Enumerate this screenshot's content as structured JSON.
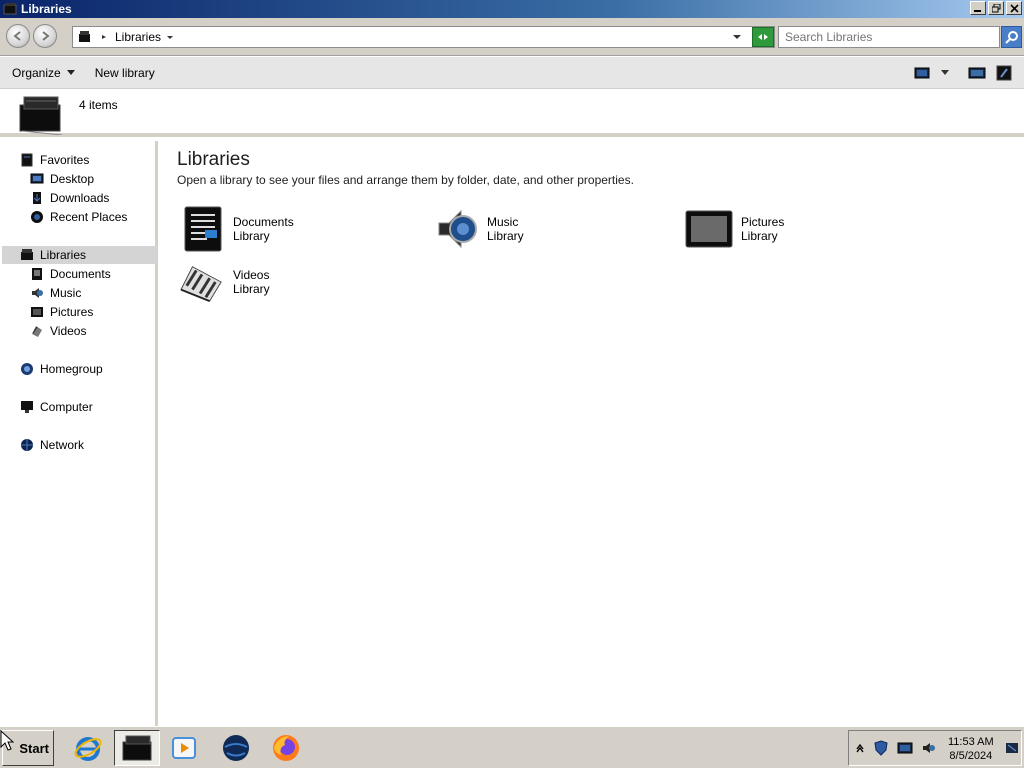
{
  "window": {
    "title": "Libraries"
  },
  "address": {
    "crumb": "Libraries",
    "search_placeholder": "Search Libraries"
  },
  "commands": {
    "organize": "Organize",
    "new_library": "New library"
  },
  "details": {
    "count": "4 items"
  },
  "nav": {
    "favorites": "Favorites",
    "desktop": "Desktop",
    "downloads": "Downloads",
    "recent": "Recent Places",
    "libraries": "Libraries",
    "documents": "Documents",
    "music": "Music",
    "pictures": "Pictures",
    "videos": "Videos",
    "homegroup": "Homegroup",
    "computer": "Computer",
    "network": "Network"
  },
  "content": {
    "heading": "Libraries",
    "description": "Open a library to see your files and arrange them by folder, date, and other properties.",
    "libraries": [
      {
        "name": "Documents",
        "type": "Library"
      },
      {
        "name": "Music",
        "type": "Library"
      },
      {
        "name": "Pictures",
        "type": "Library"
      },
      {
        "name": "Videos",
        "type": "Library"
      }
    ]
  },
  "taskbar": {
    "start": "Start",
    "time": "11:53 AM",
    "date": "8/5/2024"
  },
  "colors": {
    "titlebar": "#0a246a",
    "selection": "#d4d4d4",
    "chrome": "#d4d0c8"
  }
}
